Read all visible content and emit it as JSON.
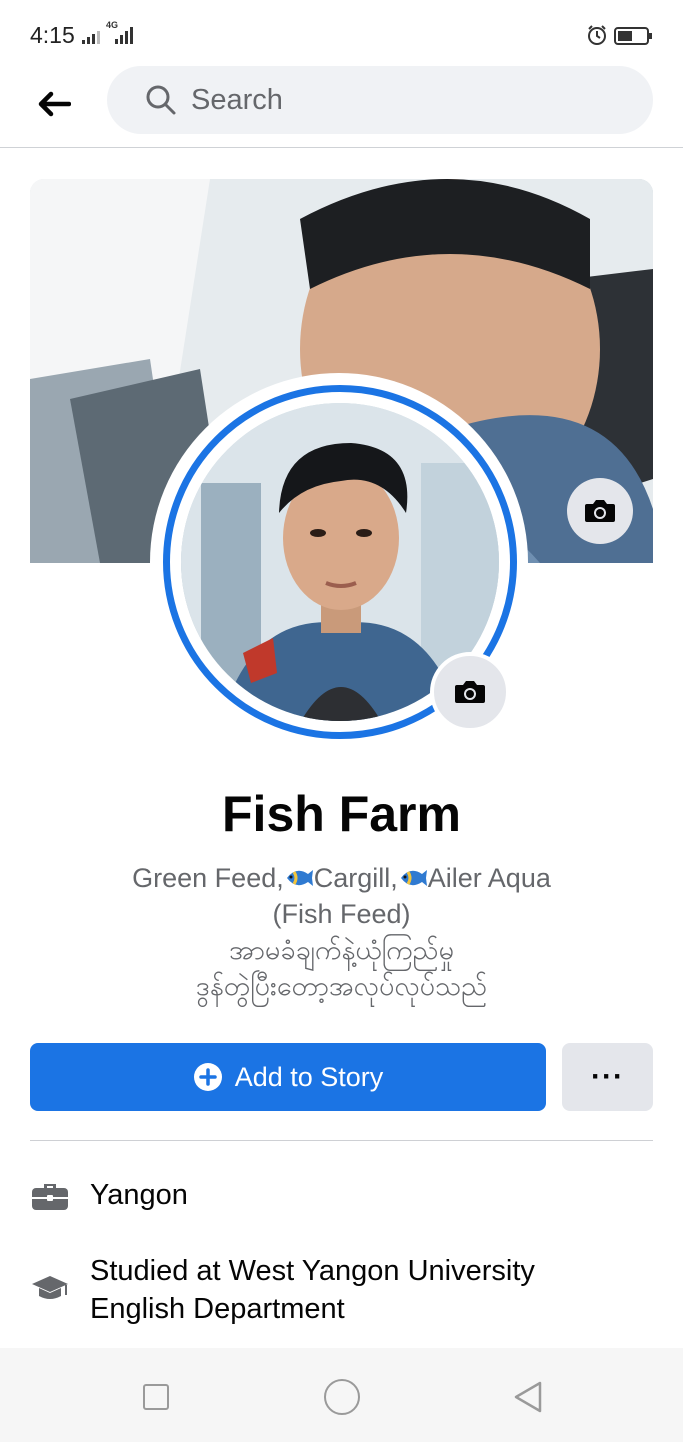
{
  "status_bar": {
    "time": "4:15",
    "network": "4G"
  },
  "header": {
    "search_placeholder": "Search"
  },
  "profile": {
    "name": "Fish Farm",
    "bio": {
      "line1_part1": "Green Feed,",
      "line1_part2": "Cargill,",
      "line1_part3": "Ailer Aqua",
      "line2": "(Fish Feed)",
      "line3": "အာမခံချက်နဲ့ယုံကြည်မှု",
      "line4": "ဒွန်တွဲပြီးတော့အလုပ်လုပ်သည်"
    }
  },
  "actions": {
    "add_story_label": "Add to Story",
    "more_label": "···"
  },
  "details": {
    "work": "Yangon",
    "education_line1": "Studied at West Yangon University",
    "education_line2": "English Department"
  },
  "icons": {
    "back": "back-arrow-icon",
    "search": "search-icon",
    "camera": "camera-icon",
    "plus": "plus-circle-icon",
    "briefcase": "briefcase-icon",
    "graduation": "graduation-cap-icon"
  },
  "colors": {
    "accent": "#1b74e4",
    "secondary_text": "#65676b",
    "button_gray": "#e4e6eb"
  }
}
